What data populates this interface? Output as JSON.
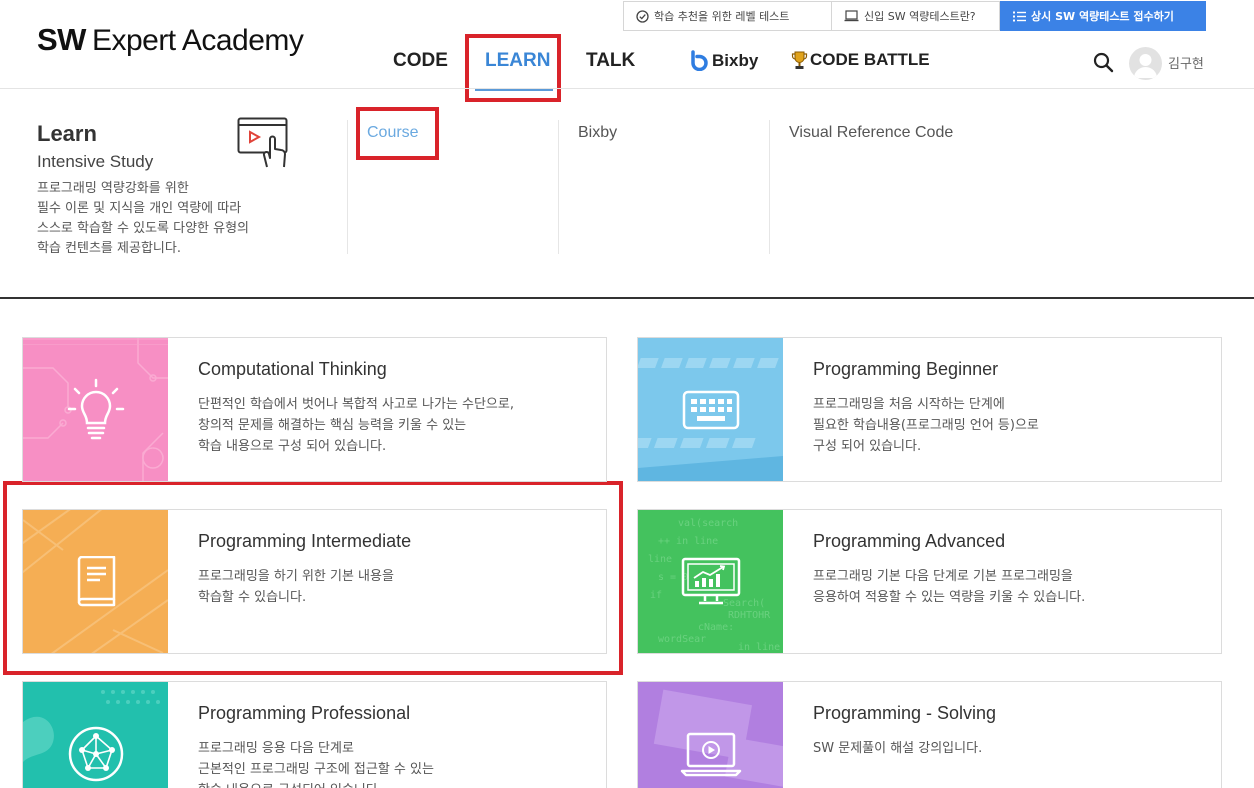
{
  "header": {
    "logo_bold": "SW",
    "logo_rest": "Expert Academy",
    "util_links": [
      "학습 추천을 위한 레벨 테스트",
      "신입 SW 역량테스트란?",
      "상시 SW 역량테스트 접수하기"
    ],
    "nav": [
      "CODE",
      "LEARN",
      "TALK",
      "Bixby",
      "CODE BATTLE"
    ],
    "active_nav": "LEARN",
    "user_name": "김구현",
    "icons": [
      "check-circle-icon",
      "laptop-icon",
      "list-icon",
      "search-icon",
      "avatar",
      "bixby-logo-icon",
      "trophy-icon"
    ],
    "colors": {
      "accent": "#3a86d6",
      "cta": "#3b82e6",
      "highlight_red": "#d9232a"
    }
  },
  "menu": {
    "title": "Learn",
    "subtitle": "Intensive Study",
    "description": [
      "프로그래밍 역량강화를 위한",
      "필수 이론 및 지식을 개인 역량에 따라",
      "스스로 학습할 수 있도록 다양한 유형의",
      "학습 컨텐츠를 제공합니다."
    ],
    "links": [
      "Course",
      "Bixby",
      "Visual Reference Code"
    ],
    "active_link": "Course"
  },
  "courses": [
    {
      "title": "Computational Thinking",
      "desc": [
        "단편적인 학습에서 벗어나 복합적 사고로 나가는 수단으로,",
        "창의적 문제를 해결하는 핵심 능력을 키울 수 있는",
        "학습 내용으로 구성 되어 있습니다."
      ],
      "color": "#f78fc4",
      "icon": "lightbulb-icon"
    },
    {
      "title": "Programming Beginner",
      "desc": [
        "프로그래밍을 처음 시작하는 단계에",
        "필요한 학습내용(프로그래밍 언어 등)으로",
        "구성 되어 있습니다."
      ],
      "color": "#7cc8ec",
      "icon": "keyboard-icon"
    },
    {
      "title": "Programming Intermediate",
      "desc": [
        "프로그래밍을 하기 위한 기본 내용을",
        "학습할 수 있습니다."
      ],
      "color": "#f5ae54",
      "icon": "book-icon"
    },
    {
      "title": "Programming Advanced",
      "desc": [
        "프로그래밍 기본 다음 단계로 기본 프로그래밍을",
        "응용하여 적용할 수 있는 역량을 키울 수 있습니다."
      ],
      "color": "#44c25e",
      "icon": "chart-monitor-icon"
    },
    {
      "title": "Programming Professional",
      "desc": [
        "프로그래밍 응용 다음 단계로",
        "근본적인 프로그래밍 구조에 접근할 수 있는",
        "학습 내용으로 구성되어 있습니다."
      ],
      "color": "#22c0ad",
      "icon": "network-globe-icon"
    },
    {
      "title": "Programming - Solving",
      "desc": [
        "SW 문제풀이 해설 강의입니다."
      ],
      "color": "#b17fe0",
      "icon": "video-laptop-icon"
    }
  ]
}
